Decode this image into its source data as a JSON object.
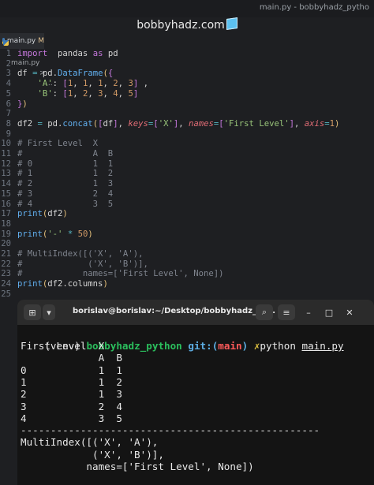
{
  "window_title": "main.py - bobbyhadz_pytho",
  "brand": "bobbyhadz.com",
  "tab": {
    "filename": "main.py",
    "modified": "M"
  },
  "breadcrumb": {
    "file": "main.py",
    "sep": ">",
    "more": "..."
  },
  "editor": {
    "lines": [
      {
        "n": "1",
        "parts": [
          [
            "kw",
            "import"
          ],
          [
            "",
            "  "
          ],
          [
            "",
            "pandas"
          ],
          [
            "",
            " "
          ],
          [
            "kw",
            "as"
          ],
          [
            "",
            " "
          ],
          [
            "",
            "pd"
          ]
        ]
      },
      {
        "n": "2",
        "parts": []
      },
      {
        "n": "3",
        "parts": [
          [
            "",
            "df "
          ],
          [
            "op",
            "="
          ],
          [
            "",
            " pd."
          ],
          [
            "fn",
            "DataFrame"
          ],
          [
            "par",
            "("
          ],
          [
            "kw",
            "{"
          ]
        ]
      },
      {
        "n": "4",
        "parts": [
          [
            "",
            "    "
          ],
          [
            "str",
            "'A'"
          ],
          [
            "",
            ": "
          ],
          [
            "kw",
            "["
          ],
          [
            "num",
            "1"
          ],
          [
            "",
            ", "
          ],
          [
            "num",
            "1"
          ],
          [
            "",
            ", "
          ],
          [
            "num",
            "1"
          ],
          [
            "",
            ", "
          ],
          [
            "num",
            "2"
          ],
          [
            "",
            ", "
          ],
          [
            "num",
            "3"
          ],
          [
            "kw",
            "]"
          ],
          [
            "",
            " ,"
          ]
        ]
      },
      {
        "n": "5",
        "parts": [
          [
            "",
            "    "
          ],
          [
            "str",
            "'B'"
          ],
          [
            "",
            ": "
          ],
          [
            "kw",
            "["
          ],
          [
            "num",
            "1"
          ],
          [
            "",
            ", "
          ],
          [
            "num",
            "2"
          ],
          [
            "",
            ", "
          ],
          [
            "num",
            "3"
          ],
          [
            "",
            ", "
          ],
          [
            "num",
            "4"
          ],
          [
            "",
            ", "
          ],
          [
            "num",
            "5"
          ],
          [
            "kw",
            "]"
          ]
        ]
      },
      {
        "n": "6",
        "parts": [
          [
            "kw",
            "}"
          ],
          [
            "par",
            ")"
          ]
        ]
      },
      {
        "n": "7",
        "parts": []
      },
      {
        "n": "8",
        "parts": [
          [
            "",
            "df2 "
          ],
          [
            "op",
            "="
          ],
          [
            "",
            " pd."
          ],
          [
            "fn",
            "concat"
          ],
          [
            "par",
            "("
          ],
          [
            "kw",
            "["
          ],
          [
            "",
            "df"
          ],
          [
            "kw",
            "]"
          ],
          [
            "",
            ", "
          ],
          [
            "kwa",
            "keys"
          ],
          [
            "op",
            "="
          ],
          [
            "kw",
            "["
          ],
          [
            "str",
            "'X'"
          ],
          [
            "kw",
            "]"
          ],
          [
            "",
            ", "
          ],
          [
            "kwa",
            "names"
          ],
          [
            "op",
            "="
          ],
          [
            "kw",
            "["
          ],
          [
            "str",
            "'First Level'"
          ],
          [
            "kw",
            "]"
          ],
          [
            "",
            ", "
          ],
          [
            "kwa",
            "axis"
          ],
          [
            "op",
            "="
          ],
          [
            "num",
            "1"
          ],
          [
            "par",
            ")"
          ]
        ]
      },
      {
        "n": "9",
        "parts": []
      },
      {
        "n": "10",
        "parts": [
          [
            "cm",
            "# First Level  X"
          ]
        ]
      },
      {
        "n": "11",
        "parts": [
          [
            "cm",
            "#              A  B"
          ]
        ]
      },
      {
        "n": "12",
        "parts": [
          [
            "cm",
            "# 0            1  1"
          ]
        ]
      },
      {
        "n": "13",
        "parts": [
          [
            "cm",
            "# 1            1  2"
          ]
        ]
      },
      {
        "n": "14",
        "parts": [
          [
            "cm",
            "# 2            1  3"
          ]
        ]
      },
      {
        "n": "15",
        "parts": [
          [
            "cm",
            "# 3            2  4"
          ]
        ]
      },
      {
        "n": "16",
        "parts": [
          [
            "cm",
            "# 4            3  5"
          ]
        ]
      },
      {
        "n": "17",
        "parts": [
          [
            "fn",
            "print"
          ],
          [
            "par",
            "("
          ],
          [
            "",
            "df2"
          ],
          [
            "par",
            ")"
          ]
        ]
      },
      {
        "n": "18",
        "parts": []
      },
      {
        "n": "19",
        "parts": [
          [
            "fn",
            "print"
          ],
          [
            "par",
            "("
          ],
          [
            "str",
            "'-'"
          ],
          [
            "",
            " "
          ],
          [
            "op",
            "*"
          ],
          [
            "",
            " "
          ],
          [
            "num",
            "50"
          ],
          [
            "par",
            ")"
          ]
        ]
      },
      {
        "n": "20",
        "parts": []
      },
      {
        "n": "21",
        "parts": [
          [
            "cm",
            "# MultiIndex([('X', 'A'),"
          ]
        ]
      },
      {
        "n": "22",
        "parts": [
          [
            "cm",
            "#             ('X', 'B')],"
          ]
        ]
      },
      {
        "n": "23",
        "parts": [
          [
            "cm",
            "#            names=['First Level', None])"
          ]
        ]
      },
      {
        "n": "24",
        "parts": [
          [
            "fn",
            "print"
          ],
          [
            "par",
            "("
          ],
          [
            "",
            "df2.columns"
          ],
          [
            "par",
            ")"
          ]
        ]
      },
      {
        "n": "25",
        "parts": []
      }
    ]
  },
  "terminal": {
    "title": "borislav@borislav:~/Desktop/bobbyhadz_py...",
    "prompt": {
      "venv": "(venv)",
      "dir": "bobbyhadz_python",
      "git": "git:(",
      "branch": "main",
      "git_close": ")",
      "mark": "✗",
      "cmd": "python",
      "arg": "main.py"
    },
    "output": [
      "First Level  X",
      "             A  B",
      "0            1  1",
      "1            1  2",
      "2            1  3",
      "3            2  4",
      "4            3  5",
      "--------------------------------------------------",
      "MultiIndex([('X', 'A'),",
      "            ('X', 'B')],",
      "           names=['First Level', None])"
    ]
  }
}
